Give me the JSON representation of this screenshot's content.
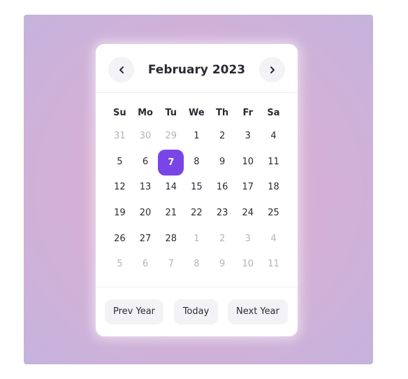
{
  "calendar": {
    "title": "February 2023",
    "weekdays": [
      "Su",
      "Mo",
      "Tu",
      "We",
      "Th",
      "Fr",
      "Sa"
    ],
    "weeks": [
      [
        {
          "d": "31",
          "muted": true
        },
        {
          "d": "30",
          "muted": true
        },
        {
          "d": "29",
          "muted": true
        },
        {
          "d": "1"
        },
        {
          "d": "2"
        },
        {
          "d": "3"
        },
        {
          "d": "4"
        }
      ],
      [
        {
          "d": "5"
        },
        {
          "d": "6"
        },
        {
          "d": "7",
          "selected": true
        },
        {
          "d": "8"
        },
        {
          "d": "9"
        },
        {
          "d": "10"
        },
        {
          "d": "11"
        }
      ],
      [
        {
          "d": "12"
        },
        {
          "d": "13"
        },
        {
          "d": "14"
        },
        {
          "d": "15"
        },
        {
          "d": "16"
        },
        {
          "d": "17"
        },
        {
          "d": "18"
        }
      ],
      [
        {
          "d": "19"
        },
        {
          "d": "20"
        },
        {
          "d": "21"
        },
        {
          "d": "22"
        },
        {
          "d": "23"
        },
        {
          "d": "24"
        },
        {
          "d": "25"
        }
      ],
      [
        {
          "d": "26"
        },
        {
          "d": "27"
        },
        {
          "d": "28"
        },
        {
          "d": "1",
          "muted": true
        },
        {
          "d": "2",
          "muted": true
        },
        {
          "d": "3",
          "muted": true
        },
        {
          "d": "4",
          "muted": true
        }
      ],
      [
        {
          "d": "5",
          "muted": true
        },
        {
          "d": "6",
          "muted": true
        },
        {
          "d": "7",
          "muted": true
        },
        {
          "d": "8",
          "muted": true
        },
        {
          "d": "9",
          "muted": true
        },
        {
          "d": "10",
          "muted": true
        },
        {
          "d": "11",
          "muted": true
        }
      ]
    ]
  },
  "nav": {
    "prev_icon": "chevron-left-icon",
    "next_icon": "chevron-right-icon"
  },
  "footer": {
    "prev_year_label": "Prev Year",
    "today_label": "Today",
    "next_year_label": "Next Year"
  },
  "colors": {
    "accent": "#7a45e6",
    "text": "#2a2a33",
    "muted": "#b3b3bb",
    "button_bg": "#f3f3f6"
  }
}
